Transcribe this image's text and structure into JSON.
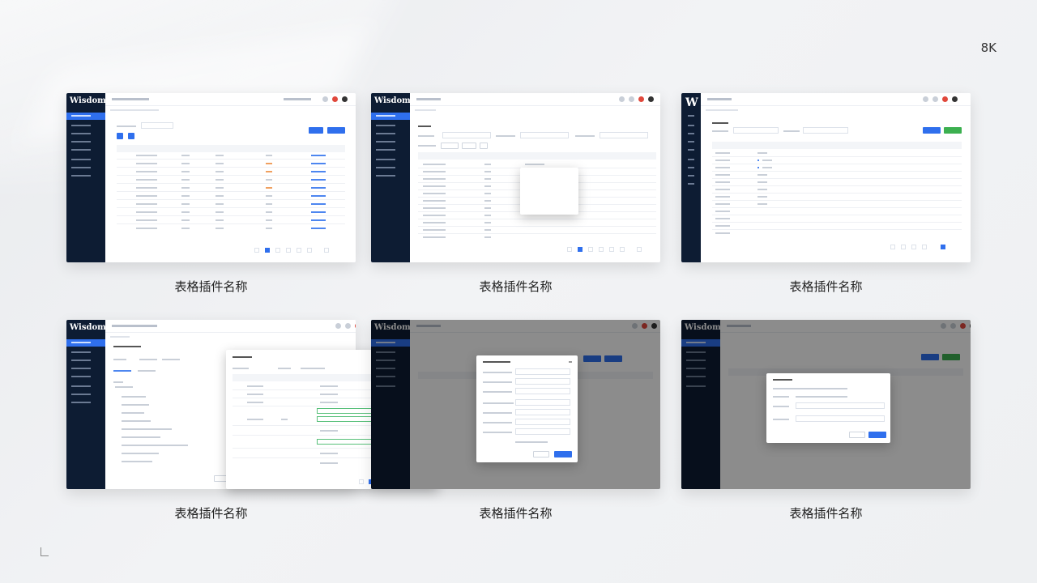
{
  "resolution_badge": "8K",
  "tiles": [
    {
      "caption": "表格插件名称",
      "logo": "Wisdom"
    },
    {
      "caption": "表格插件名称",
      "logo": "Wisdom"
    },
    {
      "caption": "表格插件名称",
      "logo": "W"
    },
    {
      "caption": "表格插件名称",
      "logo": "Wisdom"
    },
    {
      "caption": "表格插件名称",
      "logo": "Wisdom"
    },
    {
      "caption": "表格插件名称",
      "logo": "Wisdom"
    }
  ],
  "colors": {
    "sidebar": "#0d1c33",
    "primary": "#2f6fed",
    "success": "#3cb050",
    "warning": "#f0a060",
    "danger": "#e0483c"
  }
}
